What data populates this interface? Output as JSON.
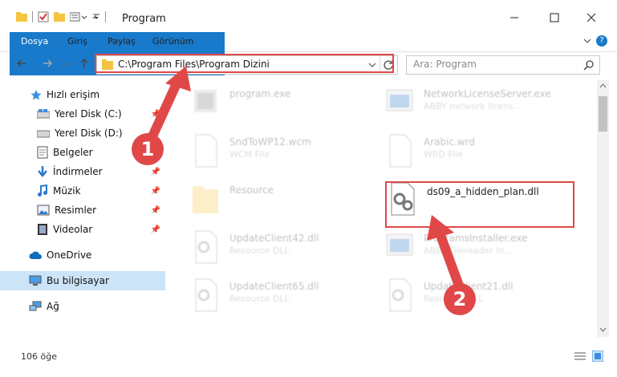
{
  "window": {
    "title": "Program"
  },
  "ribbon": {
    "tabs": [
      "Dosya",
      "Giriş",
      "Paylaş",
      "Görünüm"
    ],
    "help": "?"
  },
  "address": {
    "path": "C:\\Program Files\\Program Dizini"
  },
  "search": {
    "placeholder": "Ara: Program"
  },
  "sidebar": {
    "items": [
      {
        "label": "Hızlı erişim",
        "icon": "star-icon",
        "pinned": false
      },
      {
        "label": "Yerel Disk (C:)",
        "icon": "drive-icon",
        "pinned": true
      },
      {
        "label": "Yerel Disk (D:)",
        "icon": "drive-icon",
        "pinned": true
      },
      {
        "label": "Belgeler",
        "icon": "document-icon",
        "pinned": true
      },
      {
        "label": "İndirmeler",
        "icon": "download-icon",
        "pinned": true
      },
      {
        "label": "Müzik",
        "icon": "music-icon",
        "pinned": true
      },
      {
        "label": "Resimler",
        "icon": "picture-icon",
        "pinned": true
      },
      {
        "label": "Videolar",
        "icon": "video-icon",
        "pinned": true
      },
      {
        "label": "OneDrive",
        "icon": "cloud-icon",
        "pinned": false
      },
      {
        "label": "Bu bilgisayar",
        "icon": "computer-icon",
        "pinned": false
      },
      {
        "label": "Ağ",
        "icon": "network-icon",
        "pinned": false
      }
    ]
  },
  "files": [
    {
      "name": "program.exe",
      "type": "",
      "icon": "exe-icon"
    },
    {
      "name": "NetworkLicenseServer.exe",
      "type": "ABBY network licens...",
      "icon": "exe-icon"
    },
    {
      "name": "SndToWP12.wcm",
      "type": "WCM File",
      "icon": "file-icon"
    },
    {
      "name": "Arabic.wrd",
      "type": "WRD File",
      "icon": "file-icon"
    },
    {
      "name": "Resource",
      "type": "",
      "icon": "folder-icon"
    },
    {
      "name": "ds09_a_hidden_plan.dll",
      "type": "",
      "icon": "dll-icon"
    },
    {
      "name": "UpdateClient42.dll",
      "type": "Resource DLL",
      "icon": "dll-icon"
    },
    {
      "name": "ProgramsInstaller.exe",
      "type": "ABBY Filereader In...",
      "icon": "exe-icon"
    },
    {
      "name": "UpdateClient65.dll",
      "type": "Resource DLL",
      "icon": "dll-icon"
    },
    {
      "name": "UpdateClient21.dll",
      "type": "Resource DLL",
      "icon": "dll-icon"
    }
  ],
  "status": {
    "count": "106 öğe"
  },
  "callouts": [
    "1",
    "2"
  ],
  "colors": {
    "accent": "#1979ca",
    "highlight": "#e04848"
  }
}
